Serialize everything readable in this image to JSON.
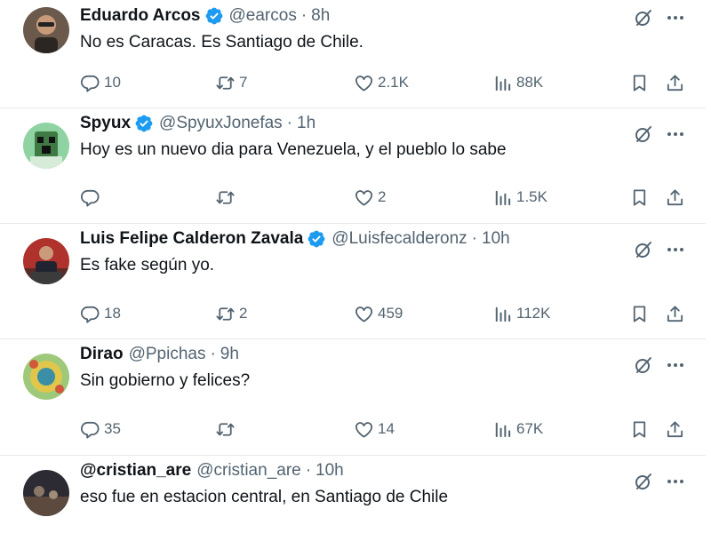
{
  "tweets": [
    {
      "name": "Eduardo Arcos",
      "verified": true,
      "handle": "@earcos",
      "dot": "·",
      "time": "8h",
      "text": "No es Caracas. Es Santiago de Chile.",
      "replies": "10",
      "retweets": "7",
      "likes": "2.1K",
      "views": "88K"
    },
    {
      "name": "Spyux",
      "verified": true,
      "handle": "@SpyuxJonefas",
      "dot": "·",
      "time": "1h",
      "text": "Hoy es un nuevo dia para Venezuela, y el pueblo lo sabe",
      "replies": "",
      "retweets": "",
      "likes": "2",
      "views": "1.5K"
    },
    {
      "name": "Luis Felipe Calderon Zavala",
      "verified": true,
      "handle": "@Luisfecalderonz",
      "dot": "·",
      "time": "10h",
      "text": "Es fake según yo.",
      "replies": "18",
      "retweets": "2",
      "likes": "459",
      "views": "112K"
    },
    {
      "name": "Dirao",
      "verified": false,
      "handle": "@Ppichas",
      "dot": "·",
      "time": "9h",
      "text": "Sin gobierno y felices?",
      "replies": "35",
      "retweets": "",
      "likes": "14",
      "views": "67K"
    },
    {
      "name": "@cristian_are",
      "verified": false,
      "handle": "@cristian_are",
      "dot": "·",
      "time": "10h",
      "text": "eso fue en estacion central, en Santiago de Chile",
      "replies": "",
      "retweets": "",
      "likes": "",
      "views": ""
    }
  ],
  "icons": {
    "grok": "grok-icon",
    "more": "more-icon",
    "reply": "reply-icon",
    "retweet": "retweet-icon",
    "like": "like-icon",
    "views": "views-icon",
    "bookmark": "bookmark-icon",
    "share": "share-icon",
    "verified": "verified-badge-icon"
  },
  "colors": {
    "text": "#0f1419",
    "muted": "#536471",
    "verified": "#1d9bf0",
    "divider": "#e7e9ea"
  }
}
